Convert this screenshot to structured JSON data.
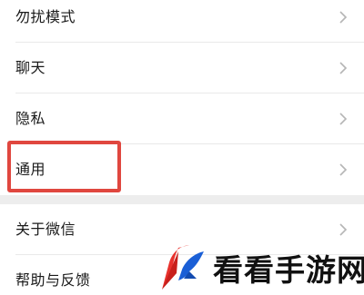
{
  "settings": {
    "items": [
      {
        "label": "勿扰模式"
      },
      {
        "label": "聊天"
      },
      {
        "label": "隐私"
      },
      {
        "label": "通用"
      },
      {
        "label": "关于微信"
      },
      {
        "label": "帮助与反馈"
      }
    ]
  },
  "highlight": {
    "target": "通用",
    "color": "#e0473f"
  },
  "watermark": {
    "text": "看看手游网",
    "brand_colors": [
      "#e8322d",
      "#1a5fd6"
    ]
  },
  "colors": {
    "background": "#ffffff",
    "divider": "#e9e9e9",
    "group_gap": "#ededed",
    "chevron": "#b5b5b5"
  }
}
